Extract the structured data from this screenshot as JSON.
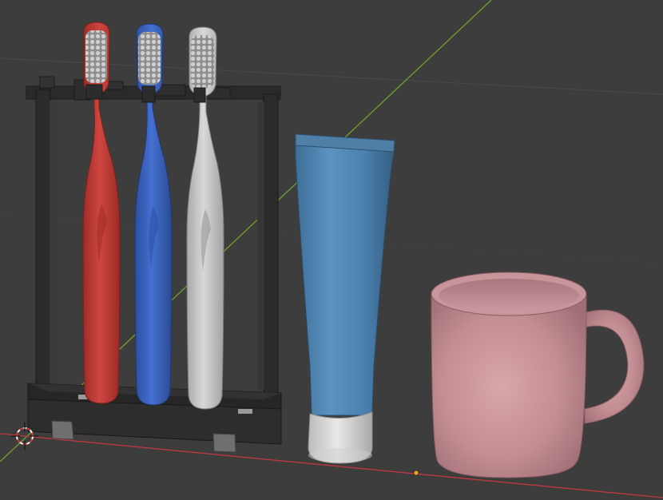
{
  "viewport": {
    "background": "#3d3d3d",
    "grid_color": "#4a4a4a",
    "x_axis_color": "#c0393f",
    "y_axis_color": "#6e9a2c"
  },
  "scene": {
    "objects": [
      {
        "name": "toothbrush-holder",
        "color": "#2f2f2f"
      },
      {
        "name": "toothbrush-red",
        "color": "#c23a35"
      },
      {
        "name": "toothbrush-blue",
        "color": "#3b63c2"
      },
      {
        "name": "toothbrush-white",
        "color": "#c8c8c8"
      },
      {
        "name": "toothpaste-tube",
        "color": "#4f86b3",
        "cap_color": "#d8d8d8"
      },
      {
        "name": "mug",
        "color": "#c28d93"
      }
    ]
  },
  "overlay": {
    "cursor_icon": "3d-cursor-icon",
    "origin_icon": "object-origin-icon"
  }
}
